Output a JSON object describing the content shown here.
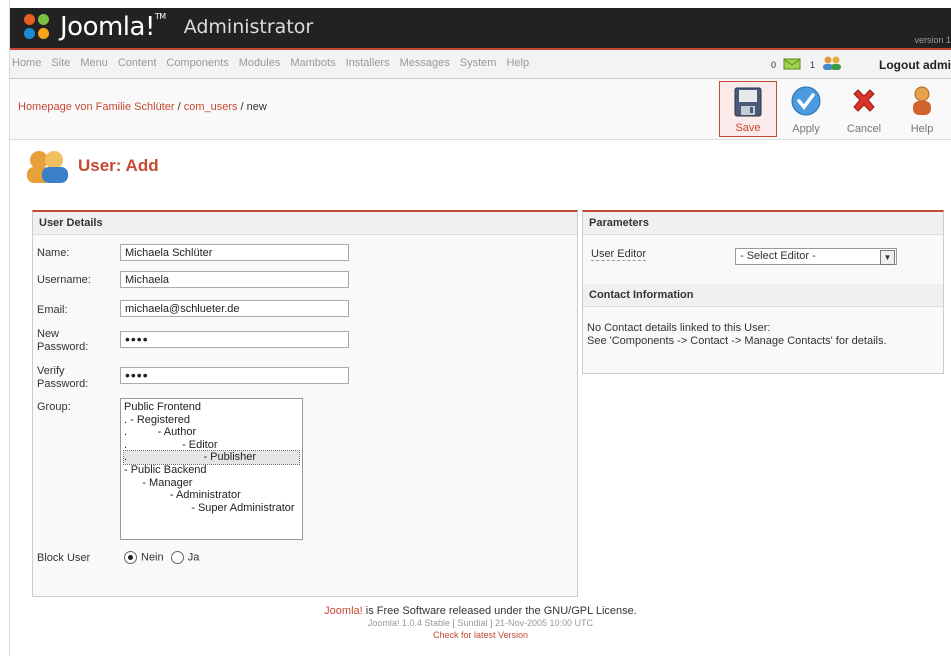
{
  "header": {
    "brand": "Joomla!",
    "brand_tm": "TM",
    "title": "Administrator",
    "version": "version 1"
  },
  "menu": [
    "Home",
    "Site",
    "Menu",
    "Content",
    "Components",
    "Modules",
    "Mambots",
    "Installers",
    "Messages",
    "System",
    "Help"
  ],
  "status": {
    "messages_count": "0",
    "users_count": "1",
    "logout_label": "Logout admi"
  },
  "breadcrumb": {
    "site": "Homepage von Familie Schlüter",
    "sep1": " / ",
    "component": "com_users",
    "sep2": " / ",
    "task": "new"
  },
  "toolbar": {
    "save": "Save",
    "apply": "Apply",
    "cancel": "Cancel",
    "help": "Help"
  },
  "page_title": "User: Add",
  "user_details": {
    "heading": "User Details",
    "name_label": "Name:",
    "name_value": "Michaela Schlüter",
    "username_label": "Username:",
    "username_value": "Michaela",
    "email_label": "Email:",
    "email_value": "michaela@schlueter.de",
    "new_password_label_1": "New",
    "new_password_label_2": "Password:",
    "new_password_value": "••••",
    "verify_password_label_1": "Verify",
    "verify_password_label_2": "Password:",
    "verify_password_value": "••••",
    "group_label": "Group:",
    "groups": [
      "Public Frontend",
      ". - Registered",
      ".          - Author",
      ".                  - Editor",
      ".                         - Publisher",
      "- Public Backend",
      "      - Manager",
      "               - Administrator",
      "                      - Super Administrator"
    ],
    "selected_group_index": 4,
    "block_label": "Block User",
    "block_no": "Nein",
    "block_yes": "Ja"
  },
  "parameters": {
    "heading": "Parameters",
    "editor_label": "User Editor",
    "editor_value": "- Select Editor -"
  },
  "contact": {
    "heading": "Contact Information",
    "line1": "No Contact details linked to this User:",
    "line2": "See 'Components -> Contact -> Manage Contacts' for details."
  },
  "footer": {
    "brand": "Joomla!",
    "line1": " is Free Software released under the GNU/GPL License.",
    "line2": "Joomla! 1.0.4 Stable [ Sundial ] 21-Nov-2005 10:00 UTC",
    "line3": "Check for latest Version"
  },
  "colors": {
    "accent": "#c64934",
    "header_bg": "#222222"
  }
}
